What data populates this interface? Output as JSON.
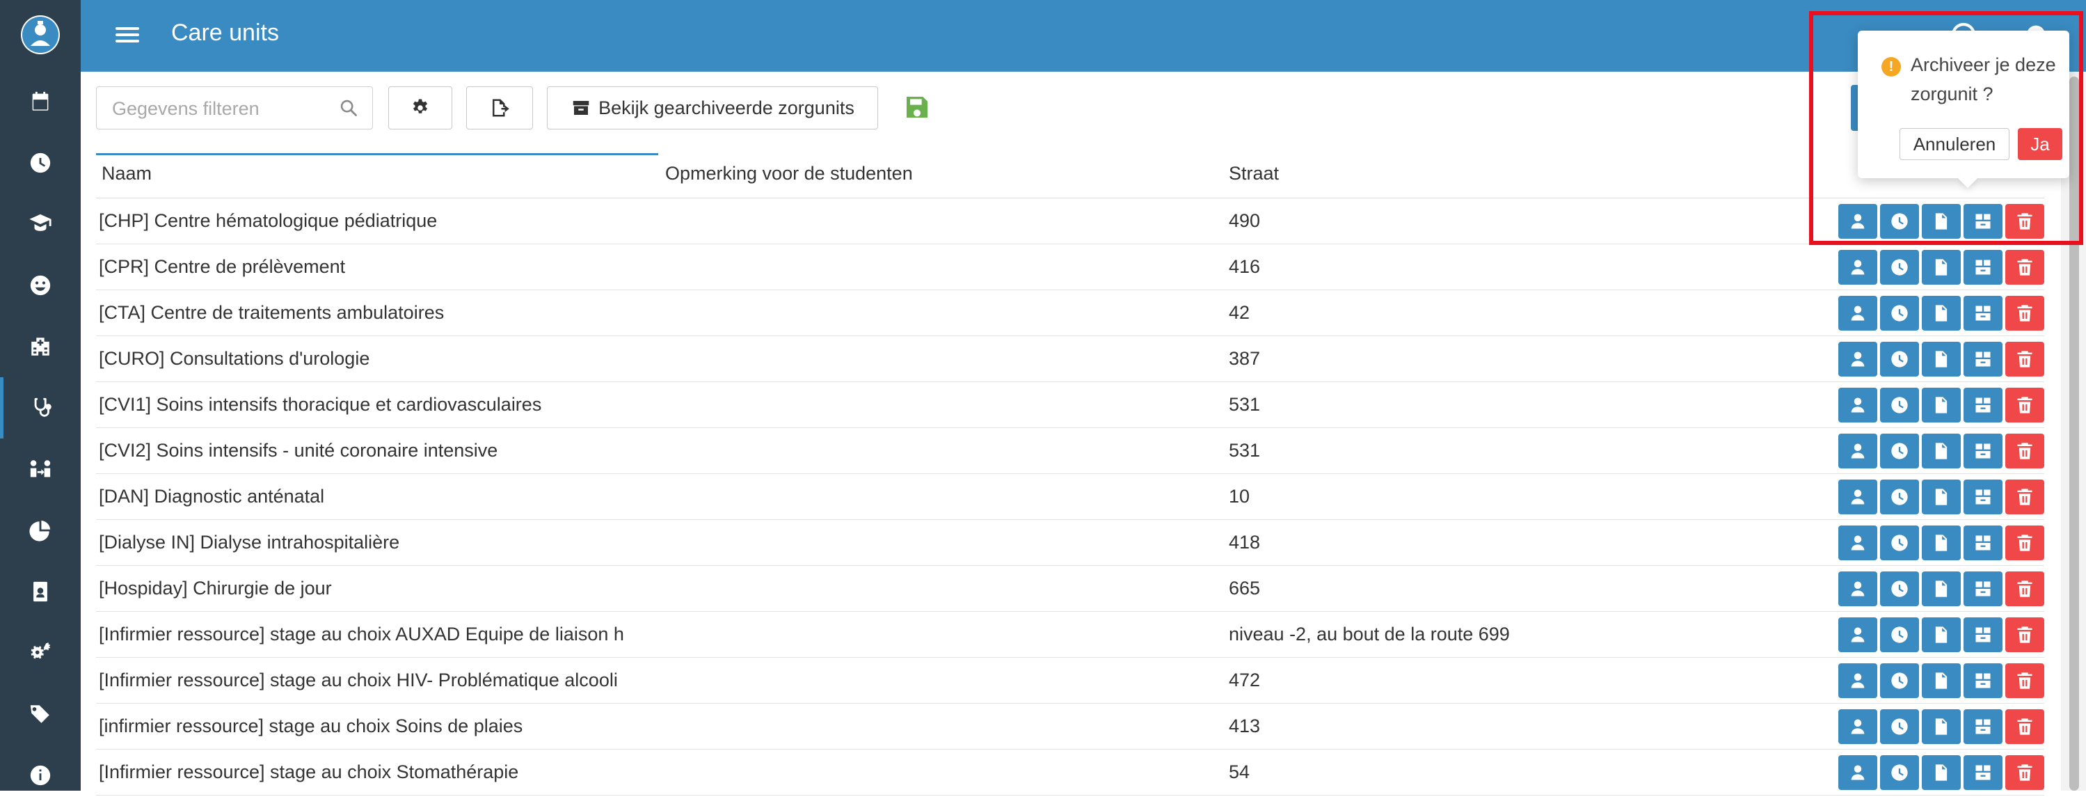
{
  "header": {
    "title": "Care units"
  },
  "toolbar": {
    "search_placeholder": "Gegevens filteren",
    "archived_button": "Bekijk gearchiveerde zorgunits"
  },
  "table": {
    "columns": [
      "Naam",
      "Opmerking voor de studenten",
      "Straat"
    ],
    "rows": [
      {
        "name": "[CHP] Centre hématologique pédiatrique",
        "note": "",
        "street": "490"
      },
      {
        "name": "[CPR] Centre de prélèvement",
        "note": "",
        "street": "416"
      },
      {
        "name": "[CTA] Centre de traitements ambulatoires",
        "note": "",
        "street": "42"
      },
      {
        "name": "[CURO] Consultations d'urologie",
        "note": "",
        "street": "387"
      },
      {
        "name": "[CVI1] Soins intensifs thoracique et cardiovasculaires",
        "note": "",
        "street": "531"
      },
      {
        "name": "[CVI2] Soins intensifs - unité coronaire intensive",
        "note": "",
        "street": "531"
      },
      {
        "name": "[DAN] Diagnostic anténatal",
        "note": "",
        "street": "10"
      },
      {
        "name": "[Dialyse IN] Dialyse intrahospitalière",
        "note": "",
        "street": "418"
      },
      {
        "name": "[Hospiday] Chirurgie de jour",
        "note": "",
        "street": "665"
      },
      {
        "name": "[Infirmier ressource] stage au choix  AUXAD Equipe de liaison h",
        "note": "",
        "street": "niveau -2, au bout de la route 699"
      },
      {
        "name": "[Infirmier ressource] stage au choix HIV- Problématique alcooli",
        "note": "",
        "street": "472"
      },
      {
        "name": "[infirmier ressource] stage au choix Soins de plaies",
        "note": "",
        "street": "413"
      },
      {
        "name": "[Infirmier ressource] stage au choix Stomathérapie",
        "note": "",
        "street": "54"
      }
    ]
  },
  "popconfirm": {
    "message": "Archiveer je deze zorgunit ?",
    "cancel_label": "Annuleren",
    "ok_label": "Ja"
  },
  "colors": {
    "primary": "#3a8bc2",
    "sidebar": "#2d3e4c",
    "danger": "#f04848",
    "warning": "#f5a623",
    "save": "#6ab04c",
    "highlight": "#e8101e"
  },
  "icons": {
    "sidebar": [
      "calendar-icon",
      "clock-icon",
      "graduate-icon",
      "smiley-icon",
      "hospital-icon",
      "stethoscope-icon",
      "people-exchange-icon",
      "pie-chart-icon",
      "id-badge-icon",
      "cogs-icon",
      "tags-icon",
      "info-icon"
    ],
    "row_actions": [
      "user-icon",
      "clock-icon",
      "document-icon",
      "archive-icon",
      "trash-icon"
    ]
  }
}
